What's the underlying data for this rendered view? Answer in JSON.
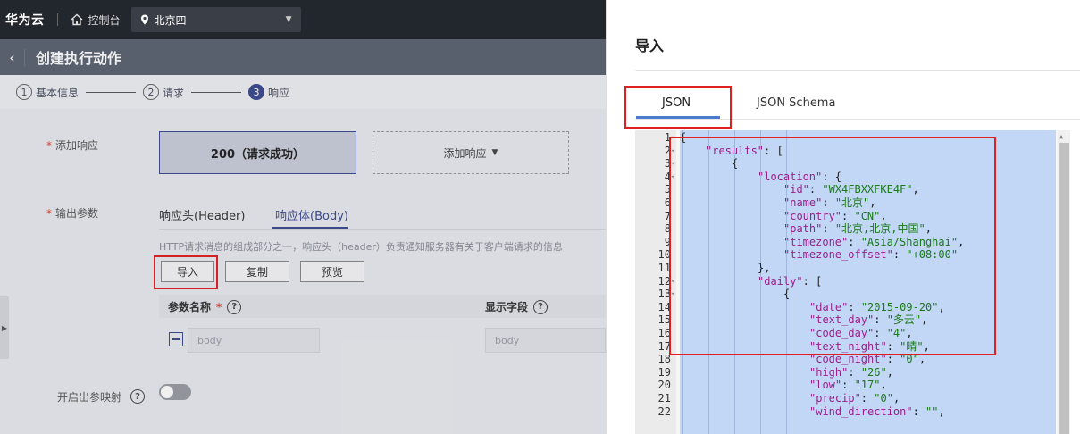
{
  "topbar": {
    "brand": "华为云",
    "console": "控制台",
    "region": "北京四"
  },
  "page": {
    "title": "创建执行动作"
  },
  "steps": [
    {
      "num": "1",
      "label": "基本信息"
    },
    {
      "num": "2",
      "label": "请求"
    },
    {
      "num": "3",
      "label": "响应"
    }
  ],
  "form": {
    "add_response_label": "添加响应",
    "response_200": "200（请求成功）",
    "add_response_btn": "添加响应",
    "output_params_label": "输出参数",
    "tab_header": "响应头(Header)",
    "tab_body": "响应体(Body)",
    "hint": "HTTP请求消息的组成部分之一，响应头（header）负责通知服务器有关于客户端请求的信息",
    "btn_import": "导入",
    "btn_copy": "复制",
    "btn_preview": "预览",
    "col_param_name": "参数名称",
    "col_display_field": "显示字段",
    "row_name_placeholder": "body",
    "row_display_placeholder": "body",
    "enable_mapping_label": "开启出参映射"
  },
  "modal": {
    "title": "导入",
    "tab_json": "JSON",
    "tab_schema": "JSON Schema",
    "lines": [
      {
        "n": "1",
        "fold": true,
        "indent": 0,
        "parts": [
          [
            "p",
            "{"
          ]
        ]
      },
      {
        "n": "2",
        "fold": true,
        "indent": 1,
        "parts": [
          [
            "k",
            "\"results\""
          ],
          [
            "p",
            ": ["
          ]
        ]
      },
      {
        "n": "3",
        "fold": true,
        "indent": 2,
        "parts": [
          [
            "p",
            "{"
          ]
        ]
      },
      {
        "n": "4",
        "fold": true,
        "indent": 3,
        "parts": [
          [
            "k",
            "\"location\""
          ],
          [
            "p",
            ": {"
          ]
        ]
      },
      {
        "n": "5",
        "fold": false,
        "indent": 4,
        "parts": [
          [
            "k",
            "\"id\""
          ],
          [
            "p",
            ": "
          ],
          [
            "s",
            "\"WX4FBXXFKE4F\""
          ],
          [
            "p",
            ","
          ]
        ]
      },
      {
        "n": "6",
        "fold": false,
        "indent": 4,
        "parts": [
          [
            "k",
            "\"name\""
          ],
          [
            "p",
            ": "
          ],
          [
            "s",
            "\"北京\""
          ],
          [
            "p",
            ","
          ]
        ]
      },
      {
        "n": "7",
        "fold": false,
        "indent": 4,
        "parts": [
          [
            "k",
            "\"country\""
          ],
          [
            "p",
            ": "
          ],
          [
            "s",
            "\"CN\""
          ],
          [
            "p",
            ","
          ]
        ]
      },
      {
        "n": "8",
        "fold": false,
        "indent": 4,
        "parts": [
          [
            "k",
            "\"path\""
          ],
          [
            "p",
            ": "
          ],
          [
            "s",
            "\"北京,北京,中国\""
          ],
          [
            "p",
            ","
          ]
        ]
      },
      {
        "n": "9",
        "fold": false,
        "indent": 4,
        "parts": [
          [
            "k",
            "\"timezone\""
          ],
          [
            "p",
            ": "
          ],
          [
            "s",
            "\"Asia/Shanghai\""
          ],
          [
            "p",
            ","
          ]
        ]
      },
      {
        "n": "10",
        "fold": false,
        "indent": 4,
        "parts": [
          [
            "k",
            "\"timezone_offset\""
          ],
          [
            "p",
            ": "
          ],
          [
            "s",
            "\"+08:00\""
          ]
        ]
      },
      {
        "n": "11",
        "fold": false,
        "indent": 3,
        "parts": [
          [
            "p",
            "},"
          ]
        ]
      },
      {
        "n": "12",
        "fold": true,
        "indent": 3,
        "parts": [
          [
            "k",
            "\"daily\""
          ],
          [
            "p",
            ": ["
          ]
        ]
      },
      {
        "n": "13",
        "fold": true,
        "indent": 4,
        "parts": [
          [
            "p",
            "{"
          ]
        ]
      },
      {
        "n": "14",
        "fold": false,
        "indent": 5,
        "parts": [
          [
            "k",
            "\"date\""
          ],
          [
            "p",
            ": "
          ],
          [
            "s",
            "\"2015-09-20\""
          ],
          [
            "p",
            ","
          ]
        ]
      },
      {
        "n": "15",
        "fold": false,
        "indent": 5,
        "parts": [
          [
            "k",
            "\"text_day\""
          ],
          [
            "p",
            ": "
          ],
          [
            "s",
            "\"多云\""
          ],
          [
            "p",
            ","
          ]
        ]
      },
      {
        "n": "16",
        "fold": false,
        "indent": 5,
        "parts": [
          [
            "k",
            "\"code_day\""
          ],
          [
            "p",
            ": "
          ],
          [
            "s",
            "\"4\""
          ],
          [
            "p",
            ","
          ]
        ]
      },
      {
        "n": "17",
        "fold": false,
        "indent": 5,
        "parts": [
          [
            "k",
            "\"text_night\""
          ],
          [
            "p",
            ": "
          ],
          [
            "s",
            "\"晴\""
          ],
          [
            "p",
            ","
          ]
        ]
      },
      {
        "n": "18",
        "fold": false,
        "indent": 5,
        "parts": [
          [
            "k",
            "\"code_night\""
          ],
          [
            "p",
            ": "
          ],
          [
            "s",
            "\"0\""
          ],
          [
            "p",
            ","
          ]
        ]
      },
      {
        "n": "19",
        "fold": false,
        "indent": 5,
        "parts": [
          [
            "k",
            "\"high\""
          ],
          [
            "p",
            ": "
          ],
          [
            "s",
            "\"26\""
          ],
          [
            "p",
            ","
          ]
        ]
      },
      {
        "n": "20",
        "fold": false,
        "indent": 5,
        "parts": [
          [
            "k",
            "\"low\""
          ],
          [
            "p",
            ": "
          ],
          [
            "s",
            "\"17\""
          ],
          [
            "p",
            ","
          ]
        ]
      },
      {
        "n": "21",
        "fold": false,
        "indent": 5,
        "parts": [
          [
            "k",
            "\"precip\""
          ],
          [
            "p",
            ": "
          ],
          [
            "s",
            "\"0\""
          ],
          [
            "p",
            ","
          ]
        ]
      },
      {
        "n": "22",
        "fold": false,
        "indent": 5,
        "parts": [
          [
            "k",
            "\"wind_direction\""
          ],
          [
            "p",
            ": "
          ],
          [
            "s",
            "\"\""
          ],
          [
            "p",
            ","
          ]
        ]
      }
    ]
  },
  "colors": {
    "accent": "#3b4a8f",
    "highlight": "#e02020",
    "selection": "#c2d6f6"
  }
}
